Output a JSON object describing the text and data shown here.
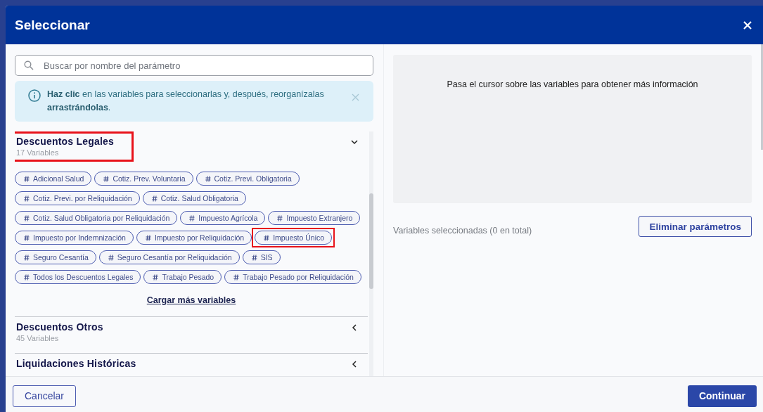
{
  "dialog": {
    "title": "Seleccionar"
  },
  "search": {
    "placeholder": "Buscar por nombre del parámetro"
  },
  "info_banner": {
    "text": "**Haz clic** en las variables para seleccionarlas y, después, reorganízalas **arrastrándolas**."
  },
  "groups": [
    {
      "title": "Descuentos Legales",
      "count": "17 Variables",
      "expanded": true,
      "highlighted": true,
      "variables": [
        {
          "label": "Adicional Salud",
          "highlighted": false
        },
        {
          "label": "Cotiz. Prev. Voluntaria",
          "highlighted": false
        },
        {
          "label": "Cotiz. Previ. Obligatoria",
          "highlighted": false
        },
        {
          "label": "Cotiz. Previ. por Reliquidación",
          "highlighted": false
        },
        {
          "label": "Cotiz. Salud Obligatoria",
          "highlighted": false
        },
        {
          "label": "Cotiz. Salud Obligatoria por Reliquidación",
          "highlighted": false
        },
        {
          "label": "Impuesto Agrícola",
          "highlighted": false
        },
        {
          "label": "Impuesto Extranjero",
          "highlighted": false
        },
        {
          "label": "Impuesto por Indemnización",
          "highlighted": false
        },
        {
          "label": "Impuesto por Reliquidación",
          "highlighted": false
        },
        {
          "label": "Impuesto Único",
          "highlighted": true
        },
        {
          "label": "Seguro Cesantía",
          "highlighted": false
        },
        {
          "label": "Seguro Cesantía por Reliquidación",
          "highlighted": false
        },
        {
          "label": "SIS",
          "highlighted": false
        },
        {
          "label": "Todos los Descuentos Legales",
          "highlighted": false
        },
        {
          "label": "Trabajo Pesado",
          "highlighted": false
        },
        {
          "label": "Trabajo Pesado por Reliquidación",
          "highlighted": false
        }
      ],
      "load_more": "Cargar más variables"
    },
    {
      "title": "Descuentos Otros",
      "count": "45 Variables",
      "expanded": false,
      "highlighted": false
    },
    {
      "title": "Liquidaciones Históricas",
      "expanded": false,
      "highlighted": false
    }
  ],
  "hover_info": "Pasa el cursor sobre las variables para obtener más información",
  "selected_summary": "Variables seleccionadas (0 en total)",
  "remove_button": "Eliminar parámetros",
  "footer": {
    "cancel": "Cancelar",
    "continue": "Continuar"
  }
}
